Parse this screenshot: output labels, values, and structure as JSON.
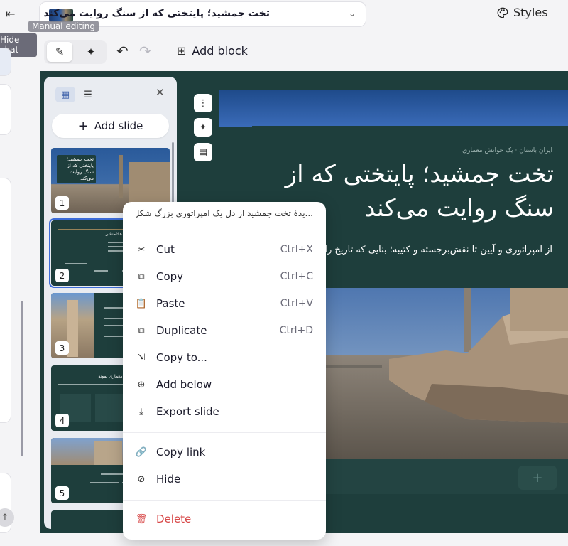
{
  "left_strip": {
    "tooltip": "Hide chat"
  },
  "header": {
    "title": "تخت جمشید؛ پایتختی که از سنگ روایت می‌کند",
    "tooltip": "Manual editing",
    "styles_label": "Styles"
  },
  "toolbar": {
    "add_block_label": "Add block"
  },
  "slide_panel": {
    "add_slide_label": "Add slide",
    "thumbnails": [
      {
        "number": "1",
        "title": "تخت جمشید؛ پایتختی که از سنگ روایت می‌کند"
      },
      {
        "number": "2",
        "title": "پارسه؛ قلب امپراتوری هخامنشی"
      },
      {
        "number": "3",
        "title": ""
      },
      {
        "number": "4",
        "title": "تخت جمشید؛ یک شهر معماری نمونه"
      },
      {
        "number": "5",
        "title": ""
      }
    ]
  },
  "slide": {
    "kicker": "ایران باستان · یک خوانش معماری",
    "title": "تخت جمشید؛ پایتختی که از سنگ روایت می‌کند",
    "description": "از امپراتوری و آیین تا نقش‌برجسته و کتیبه؛ بنایی که تاریخ را بازگو می‌کند."
  },
  "context_menu": {
    "header": "...یدهٔ تخت جمشید از دل یک امپراتوری بزرگ شکل",
    "items": [
      {
        "label": "Cut",
        "shortcut": "Ctrl+X",
        "icon": "scissors-icon"
      },
      {
        "label": "Copy",
        "shortcut": "Ctrl+C",
        "icon": "copy-icon"
      },
      {
        "label": "Paste",
        "shortcut": "Ctrl+V",
        "icon": "paste-icon"
      },
      {
        "label": "Duplicate",
        "shortcut": "Ctrl+D",
        "icon": "duplicate-icon"
      },
      {
        "label": "Copy to...",
        "shortcut": "",
        "icon": "copy-to-icon"
      },
      {
        "label": "Add below",
        "shortcut": "",
        "icon": "add-below-icon"
      },
      {
        "label": "Export slide",
        "shortcut": "",
        "icon": "export-icon"
      },
      {
        "label": "Copy link",
        "shortcut": "",
        "icon": "link-icon"
      },
      {
        "label": "Hide",
        "shortcut": "",
        "icon": "eye-off-icon"
      },
      {
        "label": "Delete",
        "shortcut": "",
        "icon": "trash-icon"
      }
    ]
  }
}
